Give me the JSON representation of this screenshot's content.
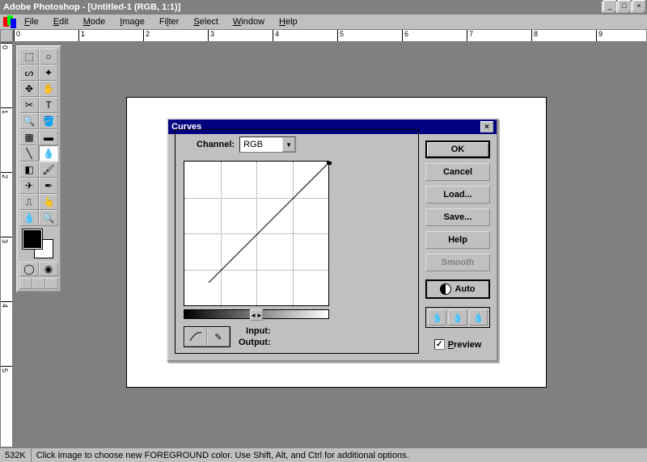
{
  "title": "Adobe Photoshop - [Untitled-1  (RGB, 1:1)]",
  "menu": {
    "file": "File",
    "edit": "Edit",
    "mode": "Mode",
    "image": "Image",
    "filter": "Filter",
    "select": "Select",
    "window": "Window",
    "help": "Help"
  },
  "ruler_marks": [
    "0",
    "1",
    "2",
    "3",
    "4",
    "5",
    "6",
    "7",
    "8",
    "9"
  ],
  "ruler_marks_v": [
    "0",
    "1",
    "2",
    "3",
    "4",
    "5"
  ],
  "dialog": {
    "title": "Curves",
    "channel_label": "Channel:",
    "channel_value": "RGB",
    "input_label": "Input:",
    "output_label": "Output:",
    "buttons": {
      "ok": "OK",
      "cancel": "Cancel",
      "load": "Load...",
      "save": "Save...",
      "help": "Help",
      "smooth": "Smooth",
      "auto": "Auto"
    },
    "preview_label": "Preview",
    "preview_checked": "✓"
  },
  "status": {
    "size": "532K",
    "hint": "Click image to choose new FOREGROUND color. Use Shift, Alt, and Ctrl for additional options."
  }
}
